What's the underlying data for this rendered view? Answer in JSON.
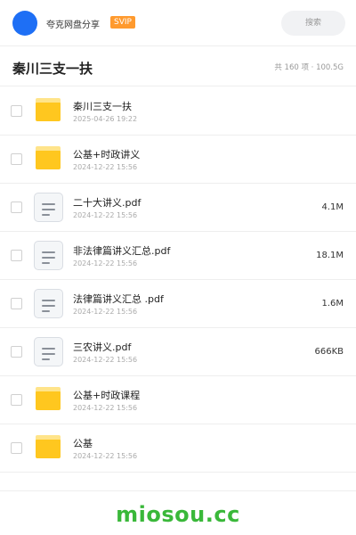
{
  "topbar": {
    "brand": "夸克网盘分享",
    "badge": "SVIP",
    "search_placeholder": "搜索"
  },
  "header": {
    "title": "秦川三支一扶",
    "summary": "共 160 项 · 100.5G"
  },
  "files": [
    {
      "name": "秦川三支一扶",
      "date": "2025-04-26 19:22",
      "size": "",
      "type": "folder-icon"
    },
    {
      "name": "公基+时政讲义",
      "date": "2024-12-22 15:56",
      "size": "",
      "type": "folder-icon"
    },
    {
      "name": "二十大讲义.pdf",
      "date": "2024-12-22 15:56",
      "size": "4.1M",
      "type": "document-icon"
    },
    {
      "name": "非法律篇讲义汇总.pdf",
      "date": "2024-12-22 15:56",
      "size": "18.1M",
      "type": "document-icon"
    },
    {
      "name": "法律篇讲义汇总 .pdf",
      "date": "2024-12-22 15:56",
      "size": "1.6M",
      "type": "document-icon"
    },
    {
      "name": "三农讲义.pdf",
      "date": "2024-12-22 15:56",
      "size": "666KB",
      "type": "document-icon"
    },
    {
      "name": "公基+时政课程",
      "date": "2024-12-22 15:56",
      "size": "",
      "type": "folder-icon"
    },
    {
      "name": "公基",
      "date": "2024-12-22 15:56",
      "size": "",
      "type": "folder-icon"
    }
  ],
  "footer": {
    "watermark": "miosou.cc"
  },
  "colors": {
    "accent": "#1e6ff5",
    "svip": "#ff9a2e",
    "folder": "#ffc71f",
    "watermark": "#3ab83a"
  }
}
